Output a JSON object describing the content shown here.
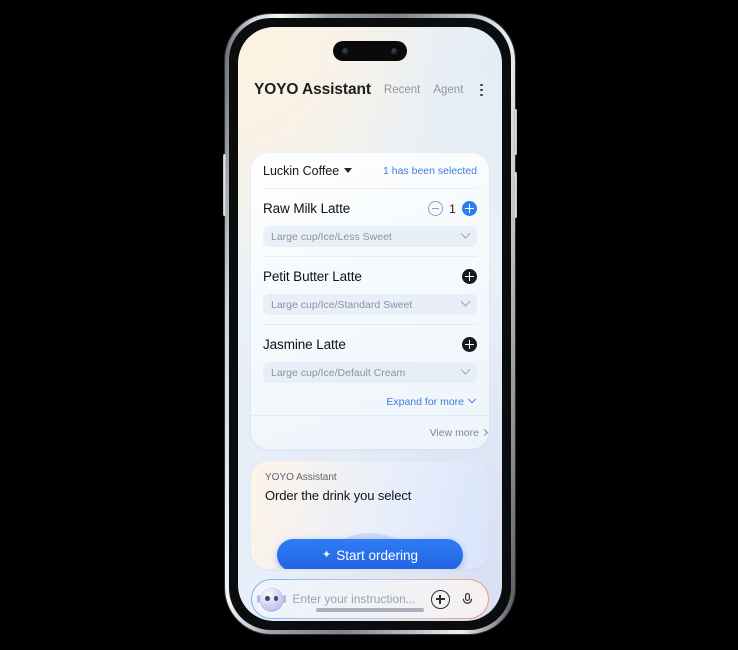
{
  "header": {
    "title": "YOYO Assistant",
    "tabs": [
      {
        "label": "Recent"
      },
      {
        "label": "Agent"
      }
    ],
    "menu_icon": "kebab-menu-icon"
  },
  "order_card": {
    "shop_name": "Luckin Coffee",
    "shop_dropdown_icon": "caret-down-icon",
    "selected_note": "1 has been selected",
    "items": [
      {
        "name": "Raw Milk Latte",
        "spec": "Large cup/Ice/Less Sweet",
        "quantity": "1",
        "has_stepper": true,
        "minus_icon": "minus-circle-icon",
        "plus_icon": "plus-circle-icon",
        "plus_color": "#2f7cf0"
      },
      {
        "name": "Petit Butter Latte",
        "spec": "Large cup/Ice/Standard Sweet",
        "quantity": "",
        "has_stepper": false,
        "plus_icon": "plus-circle-icon",
        "plus_color": "#17191c"
      },
      {
        "name": "Jasmine Latte",
        "spec": "Large cup/Ice/Default Cream",
        "quantity": "",
        "has_stepper": false,
        "plus_icon": "plus-circle-icon",
        "plus_color": "#17191c"
      }
    ],
    "expand_label": "Expand for more",
    "expand_icon": "chevron-down-icon",
    "view_more_label": "View more",
    "view_more_icon": "chevron-right-icon"
  },
  "assistant_card": {
    "label": "YOYO Assistant",
    "message": "Order the drink you select",
    "cta_label": "Start ordering",
    "cta_icon": "sparkle-icon",
    "cta_color": "#2f7cf4"
  },
  "input_bar": {
    "avatar_icon": "assistant-avatar-icon",
    "placeholder": "Enter your instruction...",
    "value": "",
    "add_icon": "plus-circle-icon",
    "mic_icon": "microphone-icon"
  },
  "system": {
    "dynamic_island": "dynamic-island",
    "home_indicator": "home-indicator"
  }
}
